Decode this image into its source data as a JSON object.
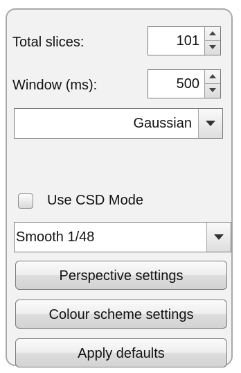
{
  "slices": {
    "label": "Total slices:",
    "value": "101"
  },
  "window": {
    "label": "Window (ms):",
    "value": "500"
  },
  "kernel_select": {
    "selected": "Gaussian"
  },
  "csd": {
    "label": "Use CSD Mode",
    "checked": false
  },
  "smooth_select": {
    "selected": "Smooth 1/48"
  },
  "buttons": {
    "perspective": "Perspective settings",
    "colour_scheme": "Colour scheme settings",
    "apply_defaults": "Apply defaults"
  },
  "icons": {
    "spin_up": "spin-up-arrow",
    "spin_down": "spin-down-arrow",
    "dropdown": "triangle-down"
  }
}
